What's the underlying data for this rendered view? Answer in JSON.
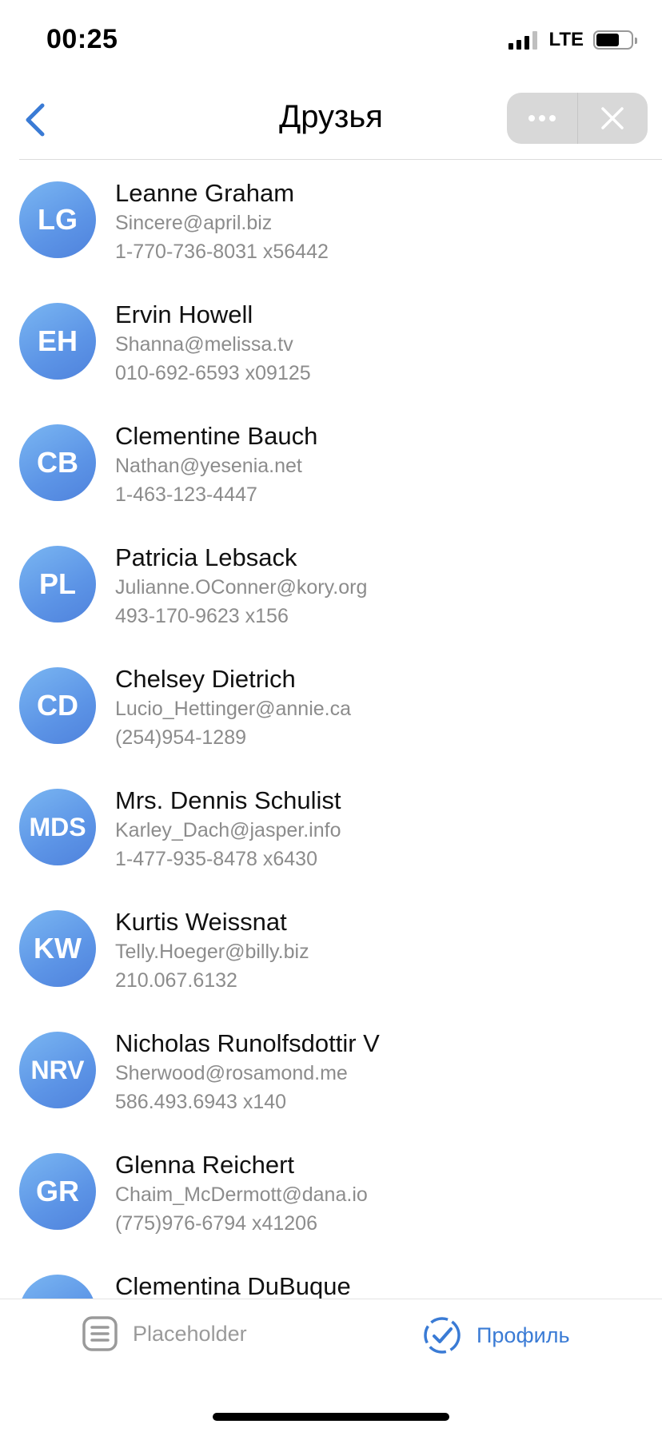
{
  "status_bar": {
    "time": "00:25",
    "network": "LTE"
  },
  "header": {
    "title": "Друзья",
    "back_icon": "chevron-left-icon",
    "more_icon": "more-dots-icon",
    "close_icon": "close-icon"
  },
  "colors": {
    "accent": "#3a7bd5",
    "avatar_gradient_start": "#7ab6f2",
    "avatar_gradient_end": "#4f82dc",
    "secondary_text": "#8c8c8c",
    "capsule_bg": "#d8d8d8"
  },
  "friends": [
    {
      "initials": "LG",
      "name": "Leanne Graham",
      "email": "Sincere@april.biz",
      "phone": "1-770-736-8031 x56442"
    },
    {
      "initials": "EH",
      "name": "Ervin Howell",
      "email": "Shanna@melissa.tv",
      "phone": "010-692-6593 x09125"
    },
    {
      "initials": "CB",
      "name": "Clementine Bauch",
      "email": "Nathan@yesenia.net",
      "phone": "1-463-123-4447"
    },
    {
      "initials": "PL",
      "name": "Patricia Lebsack",
      "email": "Julianne.OConner@kory.org",
      "phone": "493-170-9623 x156"
    },
    {
      "initials": "CD",
      "name": "Chelsey Dietrich",
      "email": "Lucio_Hettinger@annie.ca",
      "phone": "(254)954-1289"
    },
    {
      "initials": "MDS",
      "name": "Mrs. Dennis Schulist",
      "email": "Karley_Dach@jasper.info",
      "phone": "1-477-935-8478 x6430"
    },
    {
      "initials": "KW",
      "name": "Kurtis Weissnat",
      "email": "Telly.Hoeger@billy.biz",
      "phone": "210.067.6132"
    },
    {
      "initials": "NRV",
      "name": "Nicholas Runolfsdottir V",
      "email": "Sherwood@rosamond.me",
      "phone": "586.493.6943 x140"
    },
    {
      "initials": "GR",
      "name": "Glenna Reichert",
      "email": "Chaim_McDermott@dana.io",
      "phone": "(775)976-6794 x41206"
    },
    {
      "initials": "",
      "name": "Clementina DuBuque",
      "email": "",
      "phone": ""
    }
  ],
  "tabbar": {
    "items": [
      {
        "label": "Placeholder",
        "icon": "list-icon",
        "active": false
      },
      {
        "label": "Профиль",
        "icon": "check-circle-icon",
        "active": true
      }
    ]
  }
}
